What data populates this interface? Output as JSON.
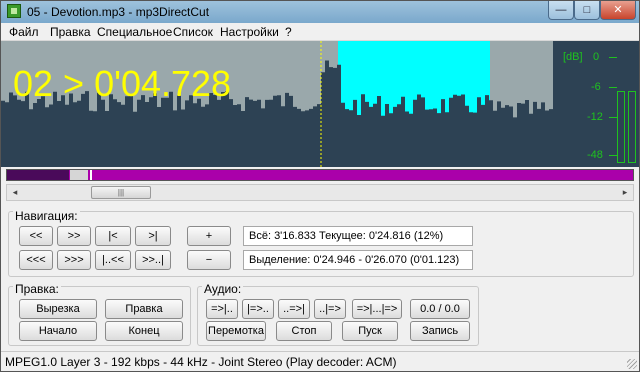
{
  "window": {
    "title": "05 - Devotion.mp3 - mp3DirectCut",
    "minimize_glyph": "—",
    "maximize_glyph": "□",
    "close_glyph": "✕"
  },
  "menu": [
    "Файл",
    "Правка",
    "Специальное",
    "Список",
    "Настройки",
    "?"
  ],
  "waveform": {
    "readout": "02 > 0'04.728",
    "colors": {
      "background": "#9aa8ab",
      "wave": "#2d4254",
      "selection": "#00ffff",
      "cursor": "#ffff00",
      "readout": "#ffff00"
    }
  },
  "meter": {
    "labels": [
      "[dB]",
      "0",
      "-6",
      "-12",
      "-48"
    ],
    "color": "#1fc21f"
  },
  "overview": {
    "colors": {
      "track": "#aa00aa",
      "played": "#4a0a5a"
    }
  },
  "scrollbar": {
    "left_arrow": "◂",
    "right_arrow": "▸",
    "thumb_grip": "|||"
  },
  "navigation": {
    "title": "Навигация:",
    "row1": [
      "<<",
      ">>",
      "|<",
      ">|"
    ],
    "row2": [
      "<<<",
      ">>>",
      "|..<<",
      ">>..|"
    ],
    "zoom_in": "+",
    "zoom_out": "−",
    "info_total": "Всё: 3'16.833   Текущее: 0'24.816  (12%)",
    "info_selection": "Выделение: 0'24.946 - 0'26.070 (0'01.123)"
  },
  "edit": {
    "title": "Правка:",
    "cut": "Вырезка",
    "edit": "Правка",
    "start": "Начало",
    "end": "Конец"
  },
  "audio": {
    "title": "Аудио:",
    "row1": [
      "=>|..",
      "|=>..",
      "..=>|",
      "..|=>",
      "=>|...|=>",
      "0.0 / 0.0"
    ],
    "rewind": "Перемотка",
    "stop": "Стоп",
    "play": "Пуск",
    "record": "Запись"
  },
  "status": "MPEG1.0 Layer 3 - 192 kbps - 44 kHz - Joint Stereo   (Play decoder: ACM)"
}
